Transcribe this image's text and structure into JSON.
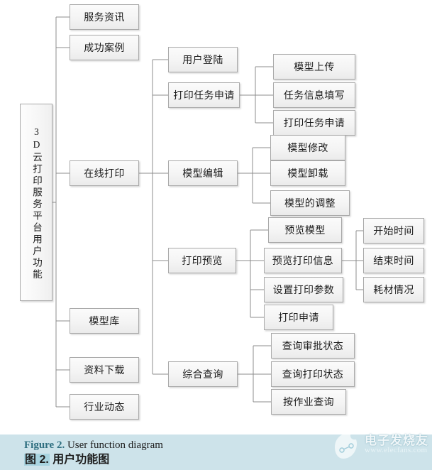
{
  "figure": {
    "caption_en_prefix": "Figure 2.",
    "caption_en_text": "User function diagram",
    "caption_zh_prefix": "图 2.",
    "caption_zh_text": "用户功能图",
    "caption_background": "#cde3ea"
  },
  "watermark": {
    "brand": "电子发烧友",
    "url": "www.elecfans.com"
  },
  "diagram": {
    "type": "tree",
    "orientation": "left-to-right",
    "root": {
      "label": "3D云打印服务平台用户功能"
    },
    "level2": [
      {
        "label": "服务资讯"
      },
      {
        "label": "成功案例"
      },
      {
        "label": "在线打印"
      },
      {
        "label": "模型库"
      },
      {
        "label": "资料下载"
      },
      {
        "label": "行业动态"
      }
    ],
    "level3": [
      {
        "label": "用户登陆"
      },
      {
        "label": "打印任务申请"
      },
      {
        "label": "模型编辑"
      },
      {
        "label": "打印预览"
      },
      {
        "label": "综合查询"
      }
    ],
    "level4": {
      "print_task_apply": [
        {
          "label": "模型上传"
        },
        {
          "label": "任务信息填写"
        },
        {
          "label": "打印任务申请"
        }
      ],
      "model_edit": [
        {
          "label": "模型修改"
        },
        {
          "label": "模型卸载"
        },
        {
          "label": "模型的调整"
        }
      ],
      "print_preview": [
        {
          "label": "预览模型"
        },
        {
          "label": "预览打印信息"
        },
        {
          "label": "设置打印参数"
        },
        {
          "label": "打印申请"
        }
      ],
      "integrated_query": [
        {
          "label": "查询审批状态"
        },
        {
          "label": "查询打印状态"
        },
        {
          "label": "按作业查询"
        }
      ]
    },
    "level5": {
      "preview_print_info": [
        {
          "label": "开始时间"
        },
        {
          "label": "结束时间"
        },
        {
          "label": "耗材情况"
        }
      ]
    },
    "style": {
      "node_border": "#a9a9a9",
      "node_fill": "#f4f4f4",
      "connector": "#8c8c8c"
    }
  }
}
